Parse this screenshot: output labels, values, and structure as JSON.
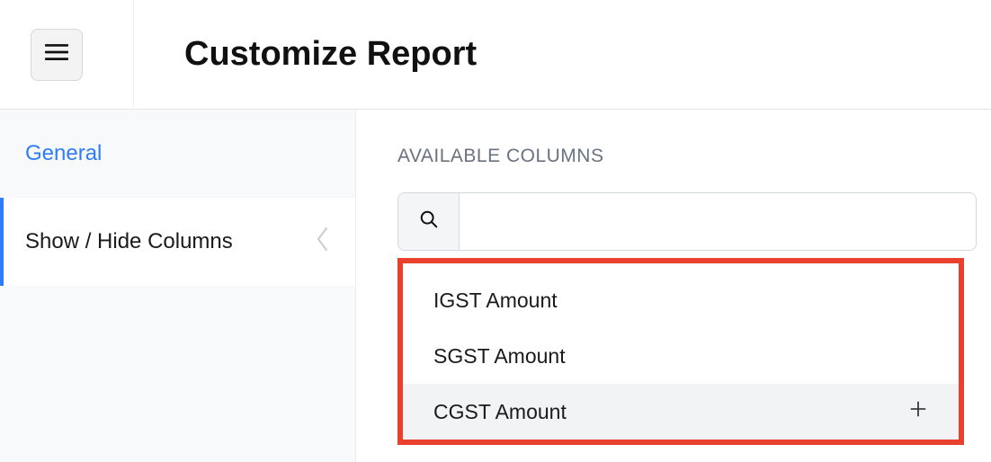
{
  "header": {
    "title": "Customize Report"
  },
  "sidebar": {
    "items": [
      {
        "label": "General"
      },
      {
        "label": "Show / Hide Columns"
      }
    ]
  },
  "main": {
    "section_label": "AVAILABLE COLUMNS",
    "search": {
      "value": ""
    },
    "columns": [
      {
        "label": "IGST Amount"
      },
      {
        "label": "SGST Amount"
      },
      {
        "label": "CGST Amount"
      }
    ]
  }
}
